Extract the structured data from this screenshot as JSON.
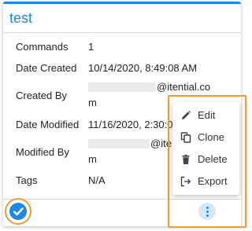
{
  "card": {
    "title": "test",
    "fields": {
      "commands": {
        "label": "Commands",
        "value": "1"
      },
      "date_created": {
        "label": "Date Created",
        "value": "10/14/2020, 8:49:08 AM"
      },
      "created_by": {
        "label": "Created By",
        "value_line1": "@itential.co",
        "value_line2": "m"
      },
      "date_modified": {
        "label": "Date Modified",
        "value": "11/16/2020, 2:30:0"
      },
      "modified_by": {
        "label": "Modified By",
        "value_line1": "@ite",
        "value_line2": "m"
      },
      "tags": {
        "label": "Tags",
        "value": "N/A"
      }
    }
  },
  "menu": {
    "items": [
      {
        "label": "Edit",
        "icon": "pencil-icon"
      },
      {
        "label": "Clone",
        "icon": "copy-icon"
      },
      {
        "label": "Delete",
        "icon": "trash-icon"
      },
      {
        "label": "Export",
        "icon": "export-icon"
      }
    ]
  },
  "footer": {
    "check_icon": "check-circle-icon",
    "more_icon": "more-vert-icon"
  },
  "colors": {
    "accent": "#1e88e5",
    "highlight": "#f39a2e"
  }
}
